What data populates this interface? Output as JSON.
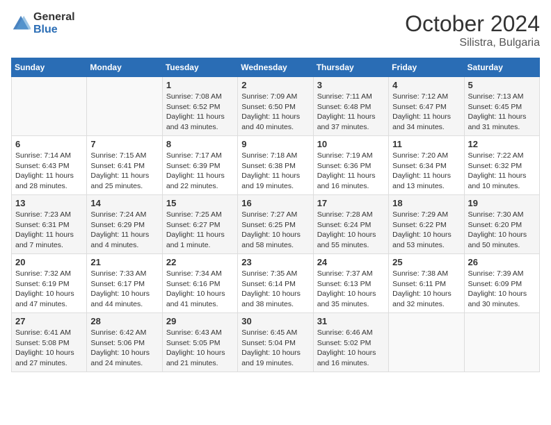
{
  "header": {
    "logo_general": "General",
    "logo_blue": "Blue",
    "month_year": "October 2024",
    "location": "Silistra, Bulgaria"
  },
  "weekdays": [
    "Sunday",
    "Monday",
    "Tuesday",
    "Wednesday",
    "Thursday",
    "Friday",
    "Saturday"
  ],
  "weeks": [
    [
      {
        "day": "",
        "info": ""
      },
      {
        "day": "",
        "info": ""
      },
      {
        "day": "1",
        "info": "Sunrise: 7:08 AM\nSunset: 6:52 PM\nDaylight: 11 hours and 43 minutes."
      },
      {
        "day": "2",
        "info": "Sunrise: 7:09 AM\nSunset: 6:50 PM\nDaylight: 11 hours and 40 minutes."
      },
      {
        "day": "3",
        "info": "Sunrise: 7:11 AM\nSunset: 6:48 PM\nDaylight: 11 hours and 37 minutes."
      },
      {
        "day": "4",
        "info": "Sunrise: 7:12 AM\nSunset: 6:47 PM\nDaylight: 11 hours and 34 minutes."
      },
      {
        "day": "5",
        "info": "Sunrise: 7:13 AM\nSunset: 6:45 PM\nDaylight: 11 hours and 31 minutes."
      }
    ],
    [
      {
        "day": "6",
        "info": "Sunrise: 7:14 AM\nSunset: 6:43 PM\nDaylight: 11 hours and 28 minutes."
      },
      {
        "day": "7",
        "info": "Sunrise: 7:15 AM\nSunset: 6:41 PM\nDaylight: 11 hours and 25 minutes."
      },
      {
        "day": "8",
        "info": "Sunrise: 7:17 AM\nSunset: 6:39 PM\nDaylight: 11 hours and 22 minutes."
      },
      {
        "day": "9",
        "info": "Sunrise: 7:18 AM\nSunset: 6:38 PM\nDaylight: 11 hours and 19 minutes."
      },
      {
        "day": "10",
        "info": "Sunrise: 7:19 AM\nSunset: 6:36 PM\nDaylight: 11 hours and 16 minutes."
      },
      {
        "day": "11",
        "info": "Sunrise: 7:20 AM\nSunset: 6:34 PM\nDaylight: 11 hours and 13 minutes."
      },
      {
        "day": "12",
        "info": "Sunrise: 7:22 AM\nSunset: 6:32 PM\nDaylight: 11 hours and 10 minutes."
      }
    ],
    [
      {
        "day": "13",
        "info": "Sunrise: 7:23 AM\nSunset: 6:31 PM\nDaylight: 11 hours and 7 minutes."
      },
      {
        "day": "14",
        "info": "Sunrise: 7:24 AM\nSunset: 6:29 PM\nDaylight: 11 hours and 4 minutes."
      },
      {
        "day": "15",
        "info": "Sunrise: 7:25 AM\nSunset: 6:27 PM\nDaylight: 11 hours and 1 minute."
      },
      {
        "day": "16",
        "info": "Sunrise: 7:27 AM\nSunset: 6:25 PM\nDaylight: 10 hours and 58 minutes."
      },
      {
        "day": "17",
        "info": "Sunrise: 7:28 AM\nSunset: 6:24 PM\nDaylight: 10 hours and 55 minutes."
      },
      {
        "day": "18",
        "info": "Sunrise: 7:29 AM\nSunset: 6:22 PM\nDaylight: 10 hours and 53 minutes."
      },
      {
        "day": "19",
        "info": "Sunrise: 7:30 AM\nSunset: 6:20 PM\nDaylight: 10 hours and 50 minutes."
      }
    ],
    [
      {
        "day": "20",
        "info": "Sunrise: 7:32 AM\nSunset: 6:19 PM\nDaylight: 10 hours and 47 minutes."
      },
      {
        "day": "21",
        "info": "Sunrise: 7:33 AM\nSunset: 6:17 PM\nDaylight: 10 hours and 44 minutes."
      },
      {
        "day": "22",
        "info": "Sunrise: 7:34 AM\nSunset: 6:16 PM\nDaylight: 10 hours and 41 minutes."
      },
      {
        "day": "23",
        "info": "Sunrise: 7:35 AM\nSunset: 6:14 PM\nDaylight: 10 hours and 38 minutes."
      },
      {
        "day": "24",
        "info": "Sunrise: 7:37 AM\nSunset: 6:13 PM\nDaylight: 10 hours and 35 minutes."
      },
      {
        "day": "25",
        "info": "Sunrise: 7:38 AM\nSunset: 6:11 PM\nDaylight: 10 hours and 32 minutes."
      },
      {
        "day": "26",
        "info": "Sunrise: 7:39 AM\nSunset: 6:09 PM\nDaylight: 10 hours and 30 minutes."
      }
    ],
    [
      {
        "day": "27",
        "info": "Sunrise: 6:41 AM\nSunset: 5:08 PM\nDaylight: 10 hours and 27 minutes."
      },
      {
        "day": "28",
        "info": "Sunrise: 6:42 AM\nSunset: 5:06 PM\nDaylight: 10 hours and 24 minutes."
      },
      {
        "day": "29",
        "info": "Sunrise: 6:43 AM\nSunset: 5:05 PM\nDaylight: 10 hours and 21 minutes."
      },
      {
        "day": "30",
        "info": "Sunrise: 6:45 AM\nSunset: 5:04 PM\nDaylight: 10 hours and 19 minutes."
      },
      {
        "day": "31",
        "info": "Sunrise: 6:46 AM\nSunset: 5:02 PM\nDaylight: 10 hours and 16 minutes."
      },
      {
        "day": "",
        "info": ""
      },
      {
        "day": "",
        "info": ""
      }
    ]
  ]
}
